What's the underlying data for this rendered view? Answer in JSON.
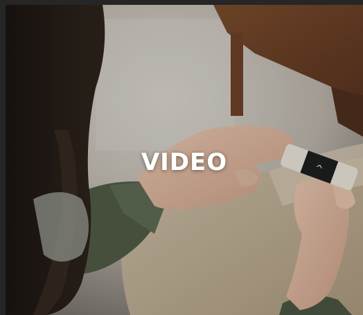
{
  "video": {
    "label": "VIDEO",
    "device_glyph": "^"
  },
  "colors": {
    "frame": "#262626",
    "label": "#ffffff",
    "device_dark": "#1d1f1f",
    "device_light": "#e8e2d6"
  }
}
